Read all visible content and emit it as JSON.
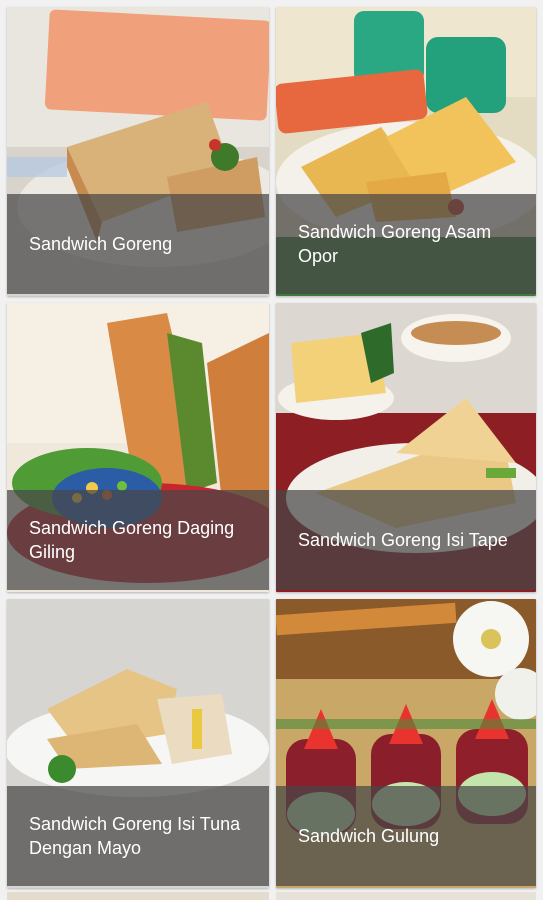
{
  "recipes": [
    {
      "title": "Sandwich Goreng"
    },
    {
      "title": "Sandwich Goreng Asam Opor"
    },
    {
      "title": "Sandwich Goreng Daging Giling"
    },
    {
      "title": "Sandwich Goreng Isi Tape"
    },
    {
      "title": "Sandwich Goreng Isi Tuna Dengan Mayo"
    },
    {
      "title": "Sandwich Gulung"
    }
  ]
}
